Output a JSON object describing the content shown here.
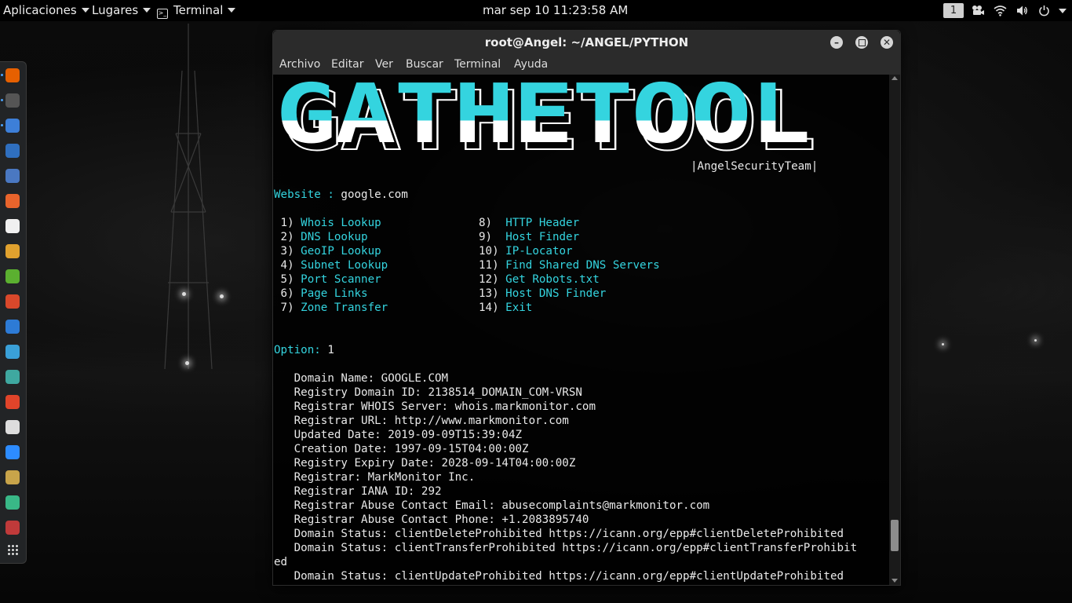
{
  "topbar": {
    "applications": "Aplicaciones",
    "places": "Lugares",
    "app_name": "Terminal",
    "clock": "mar sep 10  11:23:58 AM",
    "workspace": "1"
  },
  "window": {
    "title": "root@Angel: ~/ANGEL/PYTHON",
    "menu": [
      "Archivo",
      "Editar",
      "Ver",
      "Buscar",
      "Terminal",
      "Ayuda"
    ]
  },
  "banner": {
    "logo_text": "GATHETOOL",
    "team": "|AngelSecurityTeam|"
  },
  "website": {
    "label": "Website :",
    "value": "google.com"
  },
  "options_left": [
    {
      "num": " 1)",
      "label": "Whois Lookup"
    },
    {
      "num": " 2)",
      "label": "DNS Lookup"
    },
    {
      "num": " 3)",
      "label": "GeoIP Lookup"
    },
    {
      "num": " 4)",
      "label": "Subnet Lookup"
    },
    {
      "num": " 5)",
      "label": "Port Scanner"
    },
    {
      "num": " 6)",
      "label": "Page Links"
    },
    {
      "num": " 7)",
      "label": "Zone Transfer"
    }
  ],
  "options_right": [
    {
      "num": "8)",
      "label": "HTTP Header"
    },
    {
      "num": "9)",
      "label": "Host Finder"
    },
    {
      "num": "10)",
      "label": "IP-Locator"
    },
    {
      "num": "11)",
      "label": "Find Shared DNS Servers"
    },
    {
      "num": "12)",
      "label": "Get Robots.txt"
    },
    {
      "num": "13)",
      "label": "Host DNS Finder"
    },
    {
      "num": "14)",
      "label": "Exit"
    }
  ],
  "prompt": {
    "label": "Option:",
    "value": "1"
  },
  "output": [
    "   Domain Name: GOOGLE.COM",
    "   Registry Domain ID: 2138514_DOMAIN_COM-VRSN",
    "   Registrar WHOIS Server: whois.markmonitor.com",
    "   Registrar URL: http://www.markmonitor.com",
    "   Updated Date: 2019-09-09T15:39:04Z",
    "   Creation Date: 1997-09-15T04:00:00Z",
    "   Registry Expiry Date: 2028-09-14T04:00:00Z",
    "   Registrar: MarkMonitor Inc.",
    "   Registrar IANA ID: 292",
    "   Registrar Abuse Contact Email: abusecomplaints@markmonitor.com",
    "   Registrar Abuse Contact Phone: +1.2083895740",
    "   Domain Status: clientDeleteProhibited https://icann.org/epp#clientDeleteProhibited",
    "   Domain Status: clientTransferProhibited https://icann.org/epp#clientTransferProhibit",
    "ed",
    "   Domain Status: clientUpdateProhibited https://icann.org/epp#clientUpdateProhibited"
  ],
  "dock_apps": [
    {
      "name": "firefox",
      "color": "#e66000"
    },
    {
      "name": "terminal",
      "color": "#555555"
    },
    {
      "name": "files",
      "color": "#3d7fd8"
    },
    {
      "name": "metasploit",
      "color": "#2f6fbf"
    },
    {
      "name": "armitage",
      "color": "#4a78c2"
    },
    {
      "name": "burpsuite",
      "color": "#e8642c"
    },
    {
      "name": "maltego",
      "color": "#f0f0f0"
    },
    {
      "name": "beef",
      "color": "#e0a12e"
    },
    {
      "name": "faraday",
      "color": "#5bb030"
    },
    {
      "name": "kali-tools",
      "color": "#d9482b"
    },
    {
      "name": "wireshark",
      "color": "#2d7bd6"
    },
    {
      "name": "zaproxy",
      "color": "#3aa0d8"
    },
    {
      "name": "cutycapt",
      "color": "#3fa8a0"
    },
    {
      "name": "recordmydesktop",
      "color": "#e0442a"
    },
    {
      "name": "text-editor",
      "color": "#dddddd"
    },
    {
      "name": "zoom",
      "color": "#2d8cff"
    },
    {
      "name": "notes",
      "color": "#c8a44a"
    },
    {
      "name": "atom",
      "color": "#39b887"
    },
    {
      "name": "recorder",
      "color": "#c03a3a"
    }
  ]
}
